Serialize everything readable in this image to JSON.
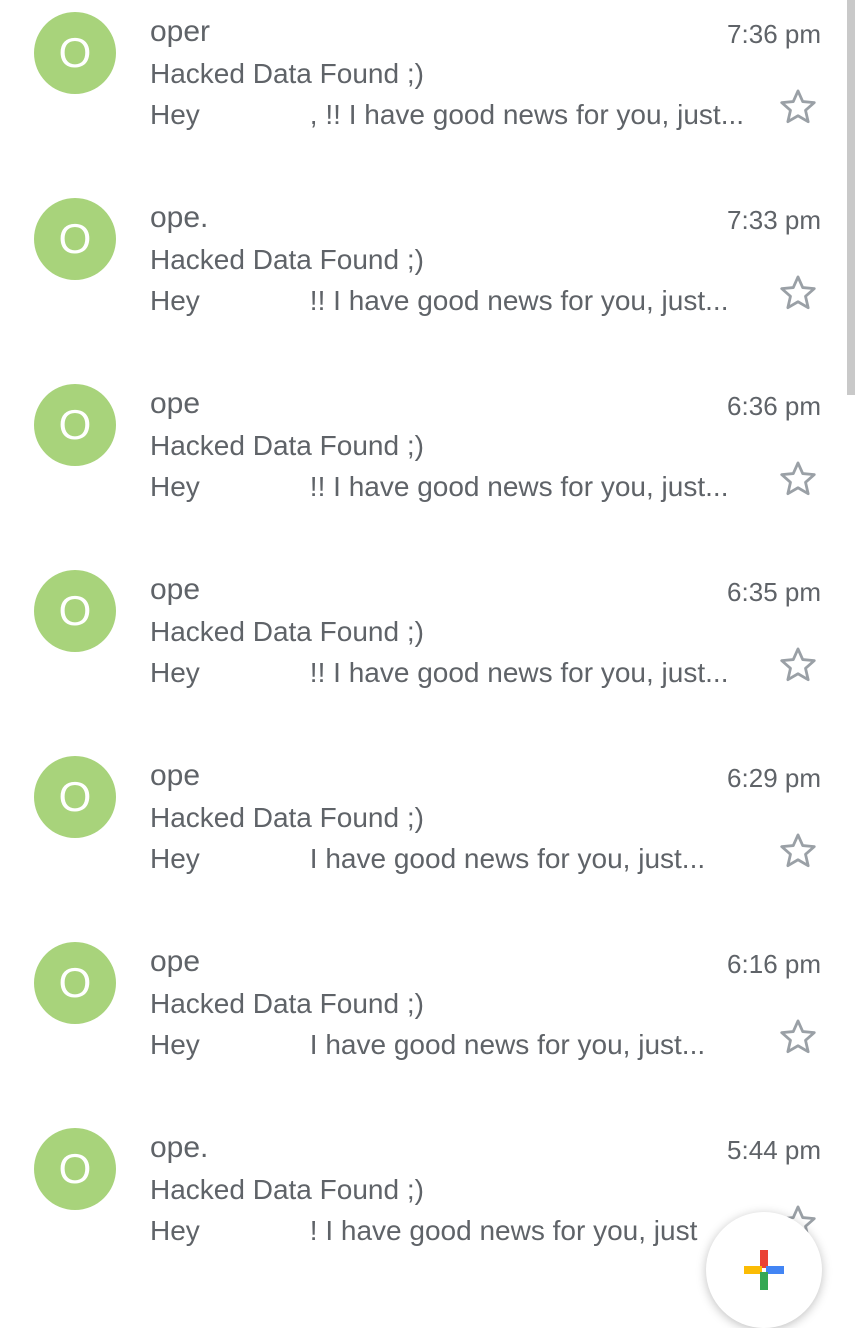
{
  "emails": [
    {
      "avatar_letter": "O",
      "sender": "oper",
      "time": "7:36 pm",
      "subject": "Hacked Data Found ;)",
      "snippet_start": "Hey",
      "snippet_end": ", !! I have good news for you, just..."
    },
    {
      "avatar_letter": "O",
      "sender": "ope.",
      "time": "7:33 pm",
      "subject": "Hacked Data Found ;)",
      "snippet_start": "Hey",
      "snippet_end": "!! I have good news for you, just..."
    },
    {
      "avatar_letter": "O",
      "sender": "ope",
      "time": "6:36 pm",
      "subject": "Hacked Data Found ;)",
      "snippet_start": "Hey",
      "snippet_end": "!! I have good news for you, just..."
    },
    {
      "avatar_letter": "O",
      "sender": "ope",
      "time": "6:35 pm",
      "subject": "Hacked Data Found ;)",
      "snippet_start": "Hey",
      "snippet_end": "!! I have good news for you, just..."
    },
    {
      "avatar_letter": "O",
      "sender": "ope",
      "time": "6:29 pm",
      "subject": "Hacked Data Found ;)",
      "snippet_start": "Hey",
      "snippet_end": "I have good news for you, just..."
    },
    {
      "avatar_letter": "O",
      "sender": "ope",
      "time": "6:16 pm",
      "subject": "Hacked Data Found ;)",
      "snippet_start": "Hey",
      "snippet_end": "I have good news for you, just..."
    },
    {
      "avatar_letter": "O",
      "sender": "ope.",
      "time": "5:44 pm",
      "subject": "Hacked Data Found ;)",
      "snippet_start": "Hey",
      "snippet_end": "! I have good news for you, just"
    }
  ],
  "icons": {
    "star": "star-outline-icon",
    "compose": "compose-plus-icon"
  },
  "colors": {
    "avatar_bg": "#a8d37b",
    "text": "#5f6368",
    "star_stroke": "#9aa0a6",
    "compose_red": "#ea4335",
    "compose_blue": "#4285f4",
    "compose_yellow": "#fbbc04",
    "compose_green": "#34a853"
  }
}
